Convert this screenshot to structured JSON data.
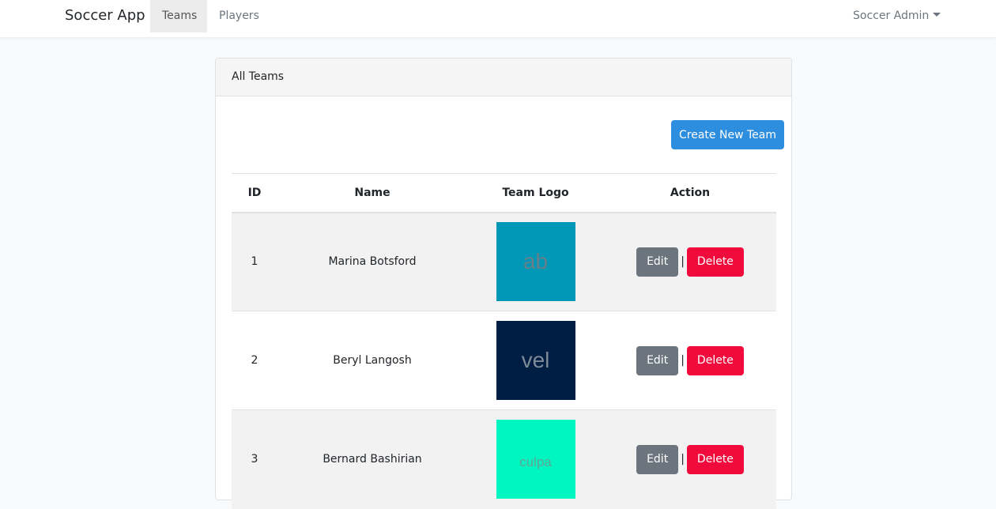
{
  "nav": {
    "brand": "Soccer App",
    "links": [
      {
        "label": "Teams",
        "active": true
      },
      {
        "label": "Players",
        "active": false
      }
    ],
    "user": "Soccer Admin"
  },
  "card": {
    "title": "All Teams",
    "create_label": "Create New Team"
  },
  "table": {
    "headers": [
      "ID",
      "Name",
      "Team Logo",
      "Action"
    ],
    "rows": [
      {
        "id": "1",
        "name": "Marina Botsford",
        "logo_text": "ab",
        "logo_bg": "#0098b6",
        "logo_color": "#687f8a"
      },
      {
        "id": "2",
        "name": "Beryl Langosh",
        "logo_text": "vel",
        "logo_bg": "#001d43",
        "logo_color": "#7d8b96"
      },
      {
        "id": "3",
        "name": "Bernard Bashirian",
        "logo_text": "culpa",
        "logo_bg": "#00f6c0",
        "logo_color": "#5fa596"
      }
    ],
    "edit_label": "Edit",
    "separator": "|",
    "delete_label": "Delete"
  },
  "colors": {
    "primary": "#2d8ee0",
    "secondary": "#6c757d",
    "danger": "#f10a3c"
  }
}
